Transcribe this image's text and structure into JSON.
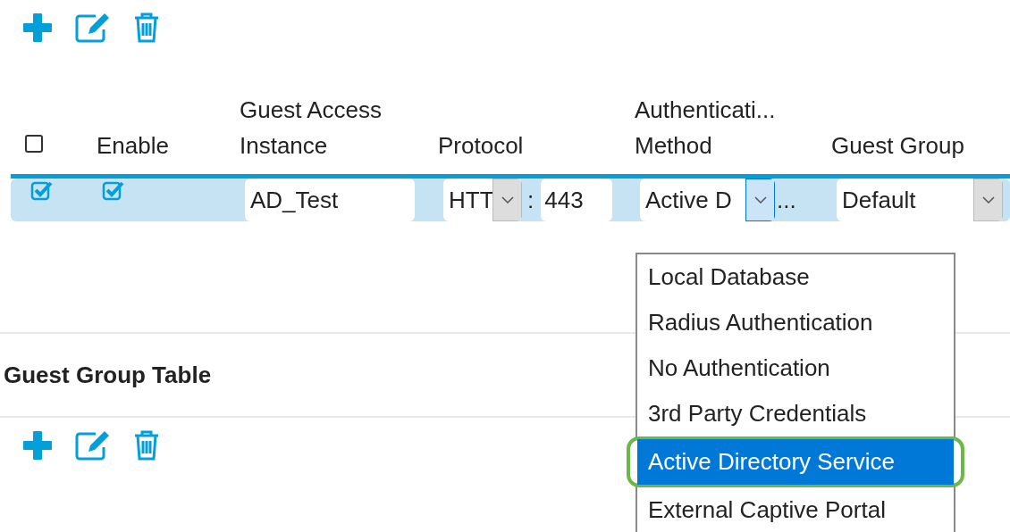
{
  "table": {
    "header_checkbox": {
      "checked": false
    },
    "columns": [
      "Enable",
      "Guest Access\nInstance",
      "Protocol",
      "Authenticati...\nMethod",
      "Guest Group"
    ],
    "rows": [
      {
        "selected": true,
        "checked": true,
        "enable": true,
        "instance": "AD_Test",
        "protocol": "HTT",
        "port_separator": ":",
        "port": "443",
        "auth_method": "Active D",
        "auth_more": "...",
        "guest_group": "Default"
      }
    ]
  },
  "auth_dropdown": {
    "options": [
      {
        "label": "Local Database",
        "selected": false,
        "highlighted": false
      },
      {
        "label": "Radius Authentication",
        "selected": false,
        "highlighted": false
      },
      {
        "label": "No Authentication",
        "selected": false,
        "highlighted": false
      },
      {
        "label": "3rd Party Credentials",
        "selected": false,
        "highlighted": false
      },
      {
        "label": "Active Directory Service",
        "selected": true,
        "highlighted": true
      },
      {
        "label": "External Captive Portal",
        "selected": false,
        "highlighted": false
      }
    ]
  },
  "section_title": "Guest Group Table"
}
